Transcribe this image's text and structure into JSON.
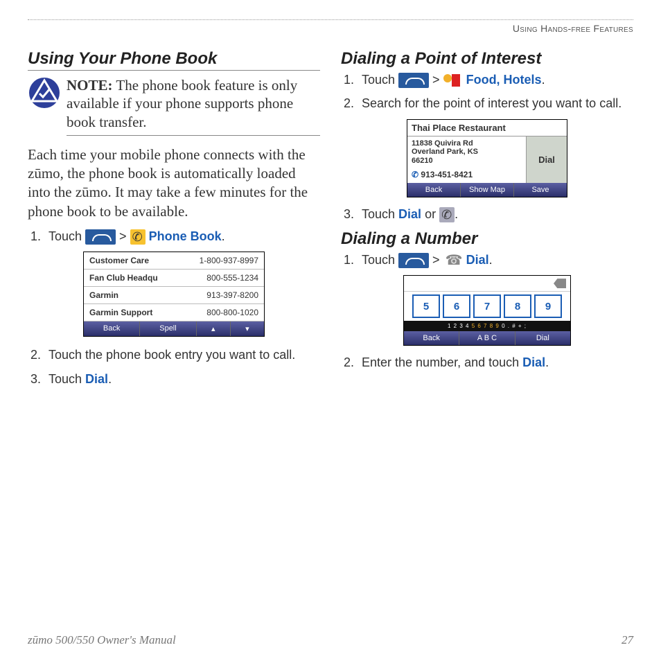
{
  "header": "Using Hands-free Features",
  "left": {
    "heading": "Using Your Phone Book",
    "note_label": "NOTE:",
    "note_text": " The phone book feature is only available if your phone supports phone book transfer.",
    "para": "Each time your mobile phone connects with the zūmo, the phone book is automatically loaded into the zūmo. It may take a few minutes for the phone book to be available.",
    "step1_a": "Touch ",
    "step1_b": " > ",
    "step1_link": "Phone Book",
    "phonebook": {
      "rows": [
        {
          "name": "Customer Care",
          "num": "1-800-937-8997"
        },
        {
          "name": "Fan Club Headqu",
          "num": "800-555-1234"
        },
        {
          "name": "Garmin",
          "num": "913-397-8200"
        },
        {
          "name": "Garmin Support",
          "num": "800-800-1020"
        }
      ],
      "back": "Back",
      "spell": "Spell",
      "up": "▴",
      "down": "▾"
    },
    "step2": "Touch the phone book entry you want to call.",
    "step3_a": "Touch ",
    "step3_link": "Dial"
  },
  "right": {
    "poi_heading": "Dialing a Point of Interest",
    "poi_step1_a": "Touch ",
    "poi_step1_b": " > ",
    "poi_step1_link": "Food, Hotels",
    "poi_step2": "Search for the point of interest you want to call.",
    "poi_mock": {
      "title": "Thai Place Restaurant",
      "addr1": "11838 Quivira Rd",
      "addr2": "Overland Park, KS",
      "addr3": "66210",
      "phone": "913-451-8421",
      "dial": "Dial",
      "back": "Back",
      "showmap": "Show Map",
      "save": "Save"
    },
    "poi_step3_a": "Touch ",
    "poi_step3_link": "Dial",
    "poi_step3_b": " or ",
    "num_heading": "Dialing a Number",
    "num_step1_a": "Touch ",
    "num_step1_b": " > ",
    "num_step1_link": "Dial",
    "dial_mock": {
      "keys": [
        "5",
        "6",
        "7",
        "8",
        "9"
      ],
      "strip_left": "1 2 3 4",
      "strip_mid": "5 6 7 8 9",
      "strip_right": "0 . # + ;",
      "back": "Back",
      "abc": "A B C",
      "dial": "Dial"
    },
    "num_step2_a": "Enter the number, and touch ",
    "num_step2_link": "Dial"
  },
  "footer": {
    "left": "zūmo 500/550 Owner's Manual",
    "right": "27"
  }
}
